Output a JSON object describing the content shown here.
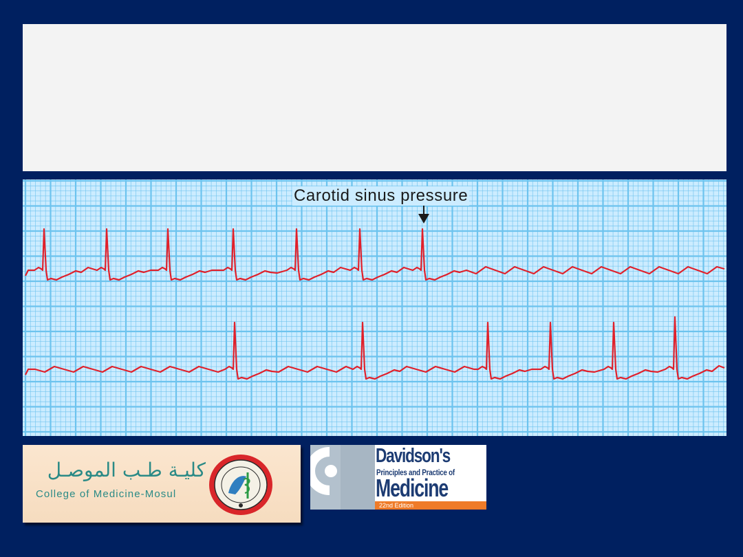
{
  "slide": {
    "background": "#002060",
    "title_panel_color": "#f3f3f3"
  },
  "ecg_strip": {
    "annotation": "Carotid sinus pressure",
    "paper_color": "#ccecff",
    "grid_color": "#6cc3ee",
    "trace_color": "#e0202a",
    "arrow_icon": "down-arrow-icon"
  },
  "logos": {
    "college": {
      "arabic_name": "كليـة طـب الموصـل",
      "english_name": "College of Medicine-Mosul",
      "seal_icon": "college-seal-icon"
    },
    "textbook": {
      "title": "Davidson's",
      "subtitle": "Principles and Practice of",
      "main": "Medicine",
      "edition": "22nd Edition",
      "accent": "#ef7b28"
    }
  }
}
